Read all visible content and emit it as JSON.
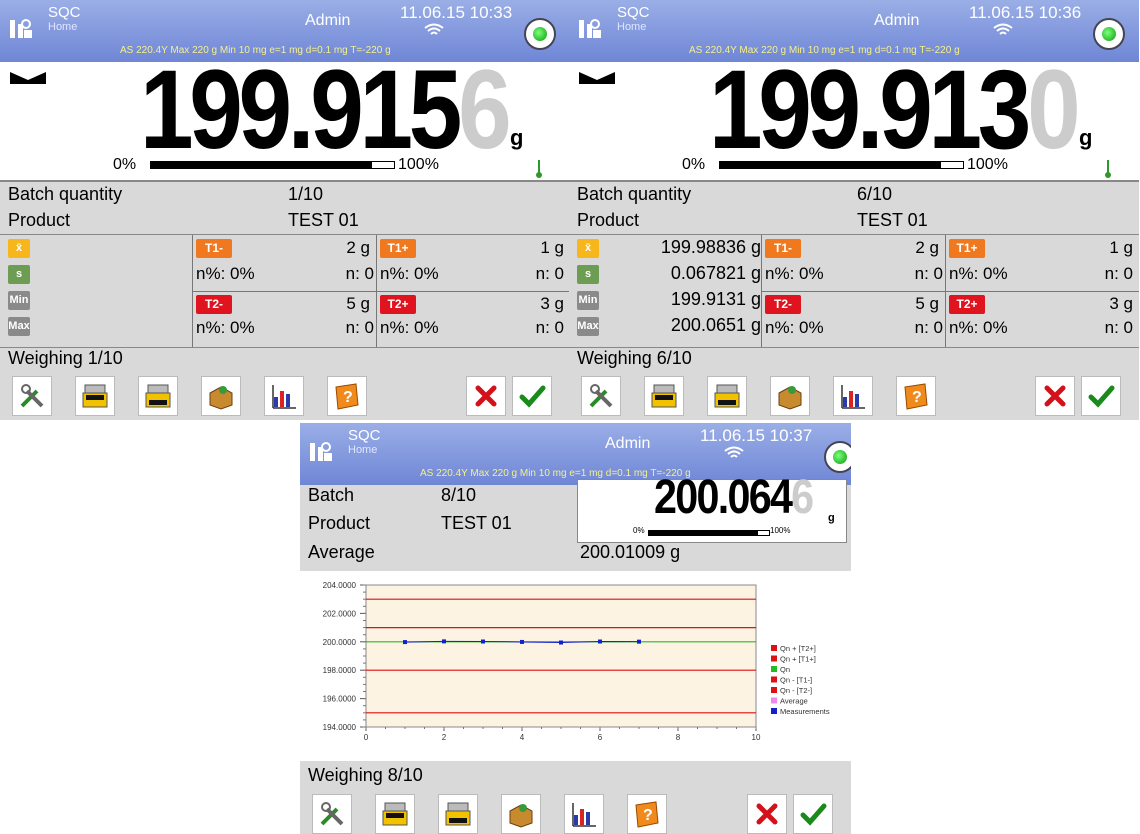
{
  "app": {
    "title": "SQC",
    "subtitle": "Home",
    "user": "Admin",
    "specs": "AS 220.4Y  Max 220 g  Min 10 mg   e=1 mg  d=0.1 mg T=-220 g"
  },
  "colors": {
    "accent": "#6f86d6",
    "xbar": "#f7b61c",
    "s": "#6d9c53",
    "minmax": "#8a8a8a",
    "t1": "#f0781e",
    "t2": "#e0141e"
  },
  "screens": [
    {
      "datetime": "11.06.15 10:33",
      "weight_main": "199.915",
      "weight_last": "6",
      "unit": "g",
      "bar_pct0": "0%",
      "bar_pct100": "100%",
      "bar_fill": 0.91,
      "batch_label": "Batch quantity",
      "batch_value": "1/10",
      "product_label": "Product",
      "product_value": "TEST 01",
      "stats": {
        "xbar": "",
        "s": "",
        "min": "",
        "max": ""
      },
      "stat_labels": {
        "xbar": "x̄",
        "s": "s",
        "min": "Min",
        "max": "Max"
      },
      "t1m": {
        "label": "T1-",
        "value": "2 g",
        "npct": "n%: 0%",
        "n": "n: 0"
      },
      "t1p": {
        "label": "T1+",
        "value": "1 g",
        "npct": "n%: 0%",
        "n": "n: 0"
      },
      "t2m": {
        "label": "T2-",
        "value": "5 g",
        "npct": "n%: 0%",
        "n": "n: 0"
      },
      "t2p": {
        "label": "T2+",
        "value": "3 g",
        "npct": "n%: 0%",
        "n": "n: 0"
      },
      "status": "Weighing 1/10"
    },
    {
      "datetime": "11.06.15 10:36",
      "weight_main": "199.913",
      "weight_last": "0",
      "unit": "g",
      "bar_pct0": "0%",
      "bar_pct100": "100%",
      "bar_fill": 0.91,
      "batch_label": "Batch quantity",
      "batch_value": "6/10",
      "product_label": "Product",
      "product_value": "TEST 01",
      "stats": {
        "xbar": "199.98836 g",
        "s": "0.067821 g",
        "min": "199.9131 g",
        "max": "200.0651 g"
      },
      "stat_labels": {
        "xbar": "x̄",
        "s": "s",
        "min": "Min",
        "max": "Max"
      },
      "t1m": {
        "label": "T1-",
        "value": "2 g",
        "npct": "n%: 0%",
        "n": "n: 0"
      },
      "t1p": {
        "label": "T1+",
        "value": "1 g",
        "npct": "n%: 0%",
        "n": "n: 0"
      },
      "t2m": {
        "label": "T2-",
        "value": "5 g",
        "npct": "n%: 0%",
        "n": "n: 0"
      },
      "t2p": {
        "label": "T2+",
        "value": "3 g",
        "npct": "n%: 0%",
        "n": "n: 0"
      },
      "status": "Weighing 6/10"
    },
    {
      "datetime": "11.06.15 10:37",
      "weight_main": "200.064",
      "weight_last": "6",
      "unit": "g",
      "bar_pct0": "0%",
      "bar_pct100": "100%",
      "bar_fill": 0.91,
      "batch_label": "Batch",
      "batch_value": "8/10",
      "product_label": "Product",
      "product_value": "TEST 01",
      "average_label": "Average",
      "average_value": "200.01009 g",
      "status": "Weighing 8/10"
    }
  ],
  "toolbar": {
    "icons": [
      "settings-tools-icon",
      "print-header-icon",
      "print-footer-icon",
      "database-box-icon",
      "statistics-chart-icon",
      "help-book-icon",
      "cancel-icon",
      "confirm-icon"
    ]
  },
  "chart_data": {
    "type": "line",
    "title": "",
    "xlabel": "",
    "ylabel": "",
    "xlim": [
      0,
      10
    ],
    "ylim": [
      194,
      204
    ],
    "x_ticks": [
      "0",
      "2",
      "4",
      "6",
      "8",
      "10"
    ],
    "y_ticks": [
      "194.0000",
      "196.0000",
      "198.0000",
      "200.0000",
      "202.0000",
      "204.0000"
    ],
    "reference_lines": [
      {
        "name": "Qn + [T2+]",
        "y": 203,
        "color": "#dd1111"
      },
      {
        "name": "Qn + [T1+]",
        "y": 201,
        "color": "#dd1111"
      },
      {
        "name": "Qn",
        "y": 200,
        "color": "#22bb22"
      },
      {
        "name": "Qn - [T1-]",
        "y": 198,
        "color": "#dd1111"
      },
      {
        "name": "Qn - [T2-]",
        "y": 195,
        "color": "#dd1111"
      }
    ],
    "series": [
      {
        "name": "Average",
        "color": "#ee88ee",
        "x": [],
        "values": []
      },
      {
        "name": "Measurements",
        "color": "#1122cc",
        "x": [
          1,
          2,
          3,
          4,
          5,
          6,
          7
        ],
        "values": [
          199.98,
          200.03,
          200.02,
          199.99,
          199.95,
          200.02,
          200.01
        ]
      }
    ],
    "legend_position": "right",
    "grid": false
  }
}
